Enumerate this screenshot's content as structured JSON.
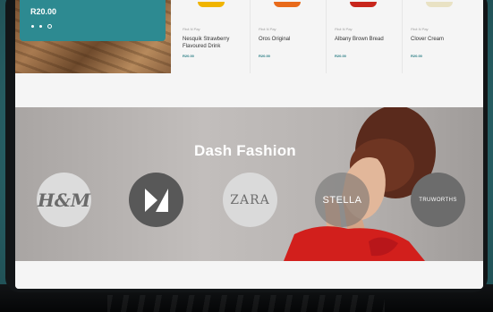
{
  "promo": {
    "price": "R20.00",
    "carousel_dots": 3,
    "active_dot": 3
  },
  "products": [
    {
      "store": "Pick N Pay",
      "name": "Nesquik Strawberry Flavoured Drink",
      "price": "R20.00",
      "swatch": "#f0b400"
    },
    {
      "store": "Pick N Pay",
      "name": "Oros Original",
      "price": "R20.00",
      "swatch": "#e86a1a"
    },
    {
      "store": "Pick N Pay",
      "name": "Albany Brown Bread",
      "price": "R20.00",
      "swatch": "#c8261c"
    },
    {
      "store": "Pick N Pay",
      "name": "Clover Cream",
      "price": "R20.00",
      "swatch": "#e9e2c4"
    }
  ],
  "fashion": {
    "title": "Dash Fashion",
    "brands": [
      {
        "name": "H&M",
        "label": "H&M"
      },
      {
        "name": "Mr Price",
        "label": ""
      },
      {
        "name": "ZARA",
        "label": "ZARA"
      },
      {
        "name": "Stella",
        "label": "STELLA"
      },
      {
        "name": "Truworths",
        "label": "TRUWORTHS"
      }
    ]
  },
  "colors": {
    "accent": "#2d8a91",
    "background": "#2f6d72"
  }
}
